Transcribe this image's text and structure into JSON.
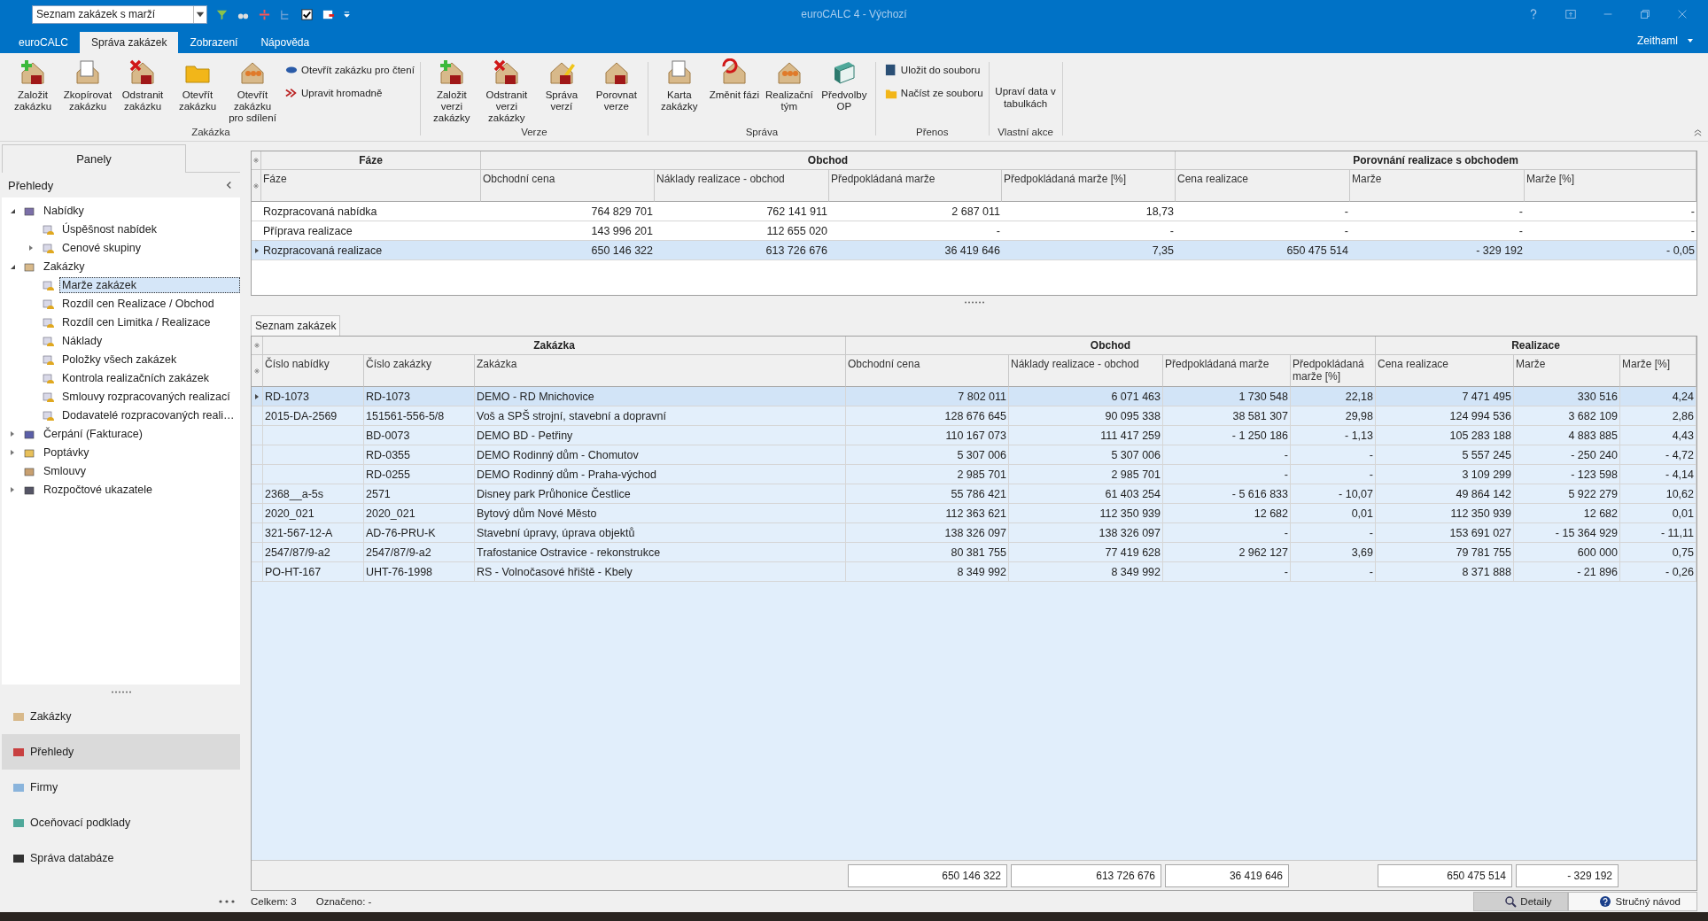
{
  "quick_access": {
    "document_selector": {
      "value": "Seznam zakázek s marží"
    }
  },
  "window": {
    "title": "euroCALC 4 - Výchozí",
    "user": "Zeithaml"
  },
  "ribbon_tabs": [
    {
      "label": "euroCALC",
      "selected": false
    },
    {
      "label": "Správa zakázek",
      "selected": true
    },
    {
      "label": "Zobrazení",
      "selected": false
    },
    {
      "label": "Nápověda",
      "selected": false
    }
  ],
  "ribbon_groups": [
    {
      "label": "Zakázka",
      "buttons": [
        {
          "label": "Založit zakázku",
          "kind": "large"
        },
        {
          "label": "Zkopírovat zakázku",
          "kind": "large"
        },
        {
          "label": "Odstranit zakázku",
          "kind": "large"
        },
        {
          "label": "Otevřít zakázku",
          "kind": "large"
        },
        {
          "label": "Otevřít zakázku pro sdílení",
          "kind": "large"
        },
        {
          "label": "Otevřít zakázku pro čtení",
          "kind": "small"
        },
        {
          "label": "Upravit hromadně",
          "kind": "small"
        }
      ]
    },
    {
      "label": "Verze",
      "buttons": [
        {
          "label": "Založit verzi zakázky",
          "kind": "large"
        },
        {
          "label": "Odstranit verzi zakázky",
          "kind": "large"
        },
        {
          "label": "Správa verzí",
          "kind": "large"
        },
        {
          "label": "Porovnat verze",
          "kind": "large"
        }
      ]
    },
    {
      "label": "Správa",
      "buttons": [
        {
          "label": "Karta zakázky",
          "kind": "large"
        },
        {
          "label": "Změnit fázi",
          "kind": "large"
        },
        {
          "label": "Realizační tým",
          "kind": "large"
        },
        {
          "label": "Předvolby OP",
          "kind": "large"
        }
      ]
    },
    {
      "label": "Přenos",
      "buttons": [
        {
          "label": "Uložit do souboru",
          "kind": "small"
        },
        {
          "label": "Načíst ze souboru",
          "kind": "small"
        }
      ]
    },
    {
      "label": "Vlastní akce",
      "buttons": [
        {
          "label": "Upraví data v tabulkách",
          "kind": "text"
        }
      ]
    }
  ],
  "sidebar": {
    "panel_tab": "Panely",
    "section_title": "Přehledy",
    "tree": [
      {
        "label": "Nabídky",
        "expanded": true,
        "selected": false,
        "children": [
          {
            "label": "Úspěšnost nabídek",
            "selected": false
          },
          {
            "label": "Cenové skupiny",
            "expanded": false,
            "selected": false
          }
        ]
      },
      {
        "label": "Zakázky",
        "expanded": true,
        "selected": false,
        "children": [
          {
            "label": "Marže zakázek",
            "selected": true
          },
          {
            "label": "Rozdíl cen Realizace / Obchod",
            "selected": false
          },
          {
            "label": "Rozdíl cen Limitka / Realizace",
            "selected": false
          },
          {
            "label": "Náklady",
            "selected": false
          },
          {
            "label": "Položky všech zakázek",
            "selected": false
          },
          {
            "label": "Kontrola realizačních zakázek",
            "selected": false
          },
          {
            "label": "Smlouvy rozpracovaných realizací",
            "selected": false
          },
          {
            "label": "Dodavatelé rozpracovaných reali…",
            "selected": false
          }
        ]
      },
      {
        "label": "Čerpání (Fakturace)",
        "expanded": false,
        "selected": false
      },
      {
        "label": "Poptávky",
        "expanded": false,
        "selected": false
      },
      {
        "label": "Smlouvy",
        "selected": false
      },
      {
        "label": "Rozpočtové ukazatele",
        "expanded": false,
        "selected": false
      }
    ],
    "nav_items": [
      {
        "label": "Zakázky",
        "selected": false
      },
      {
        "label": "Přehledy",
        "selected": true
      },
      {
        "label": "Firmy",
        "selected": false
      },
      {
        "label": "Oceňovací podklady",
        "selected": false
      },
      {
        "label": "Správa databáze",
        "selected": false
      }
    ]
  },
  "phase_table": {
    "header_groups": [
      {
        "label": "Fáze",
        "columns": [
          "Fáze"
        ]
      },
      {
        "label": "Obchod",
        "columns": [
          "Obchodní cena",
          "Náklady realizace - obchod",
          "Předpokládaná marže",
          "Předpokládaná marže [%]"
        ]
      },
      {
        "label": "Porovnání realizace s obchodem",
        "columns": [
          "Cena realizace",
          "Marže",
          "Marže [%]"
        ]
      }
    ],
    "rows": [
      {
        "selected": false,
        "cells": [
          "Rozpracovaná nabídka",
          "764 829 701",
          "762 141 911",
          "2 687 011",
          "18,73",
          "-",
          "-",
          "-"
        ]
      },
      {
        "selected": false,
        "cells": [
          "Příprava realizace",
          "143 996 201",
          "112 655 020",
          "-",
          "-",
          "-",
          "-",
          "-"
        ]
      },
      {
        "selected": true,
        "cells": [
          "Rozpracovaná realizace",
          "650 146 322",
          "613 726 676",
          "36 419 646",
          "7,35",
          "650 475 514",
          "- 329 192",
          "- 0,05"
        ]
      }
    ]
  },
  "orders_tab": "Seznam zakázek",
  "orders_table": {
    "header_groups": [
      {
        "label": "Zakázka",
        "columns": [
          "Číslo nabídky",
          "Číslo zakázky",
          "Zakázka"
        ]
      },
      {
        "label": "Obchod",
        "columns": [
          "Obchodní cena",
          "Náklady realizace - obchod",
          "Předpokládaná marže",
          "Předpokládaná marže [%]"
        ]
      },
      {
        "label": "Realizace",
        "columns": [
          "Cena realizace",
          "Marže",
          "Marže [%]"
        ]
      }
    ],
    "rows": [
      {
        "selected": true,
        "cells": [
          "RD-1073",
          "RD-1073",
          "DEMO - RD Mnichovice",
          "7 802 011",
          "6 071 463",
          "1 730 548",
          "22,18",
          "7 471 495",
          "330 516",
          "4,24"
        ]
      },
      {
        "selected": false,
        "cells": [
          "2015-DA-2569",
          "151561-556-5/8",
          "Voš a SPŠ strojní, stavební a dopravní",
          "128 676 645",
          "90 095 338",
          "38 581 307",
          "29,98",
          "124 994 536",
          "3 682 109",
          "2,86"
        ]
      },
      {
        "selected": false,
        "cells": [
          "",
          "BD-0073",
          "DEMO BD - Petřiny",
          "110 167 073",
          "111 417 259",
          "- 1 250 186",
          "- 1,13",
          "105 283 188",
          "4 883 885",
          "4,43"
        ]
      },
      {
        "selected": false,
        "cells": [
          "",
          "RD-0355",
          "DEMO Rodinný dům - Chomutov",
          "5 307 006",
          "5 307 006",
          "-",
          "-",
          "5 557 245",
          "- 250 240",
          "- 4,72"
        ]
      },
      {
        "selected": false,
        "cells": [
          "",
          "RD-0255",
          "DEMO Rodinný dům - Praha-východ",
          "2 985 701",
          "2 985 701",
          "-",
          "-",
          "3 109 299",
          "- 123 598",
          "- 4,14"
        ]
      },
      {
        "selected": false,
        "cells": [
          "2368__a-5s",
          "2571",
          "Disney park Průhonice Čestlice",
          "55 786 421",
          "61 403 254",
          "- 5 616 833",
          "- 10,07",
          "49 864 142",
          "5 922 279",
          "10,62"
        ]
      },
      {
        "selected": false,
        "cells": [
          "2020_021",
          "2020_021",
          "Bytový dům Nové Město",
          "112 363 621",
          "112 350 939",
          "12 682",
          "0,01",
          "112 350 939",
          "12 682",
          "0,01"
        ]
      },
      {
        "selected": false,
        "cells": [
          "321-567-12-A",
          "AD-76-PRU-K",
          "Stavební úpravy, úprava objektů",
          "138 326 097",
          "138 326 097",
          "-",
          "-",
          "153 691 027",
          "- 15 364 929",
          "- 11,11"
        ]
      },
      {
        "selected": false,
        "cells": [
          "2547/87/9-a2",
          "2547/87/9-a2",
          "Trafostanice Ostravice - rekonstrukce",
          "80 381 755",
          "77 419 628",
          "2 962 127",
          "3,69",
          "79 781 755",
          "600 000",
          "0,75"
        ]
      },
      {
        "selected": false,
        "cells": [
          "PO-HT-167",
          "UHT-76-1998",
          "RS - Volnočasové hřiště - Kbely",
          "8 349 992",
          "8 349 992",
          "-",
          "-",
          "8 371 888",
          "- 21 896",
          "- 0,26"
        ]
      }
    ],
    "totals": [
      {
        "kind": "blank"
      },
      {
        "kind": "blank"
      },
      {
        "kind": "blank"
      },
      {
        "kind": "total",
        "value": "650 146 322"
      },
      {
        "kind": "total",
        "value": "613 726 676"
      },
      {
        "kind": "total",
        "value": "36 419 646"
      },
      {
        "kind": "blank"
      },
      {
        "kind": "total",
        "value": "650 475 514"
      },
      {
        "kind": "total",
        "value": "- 329 192"
      },
      {
        "kind": "blank"
      }
    ]
  },
  "status_bar": {
    "texts": [
      "Celkem: 3",
      "Označeno: -"
    ],
    "buttons": [
      {
        "label": "Detaily",
        "selected": true
      },
      {
        "label": "Stručný návod",
        "selected": false
      }
    ]
  }
}
